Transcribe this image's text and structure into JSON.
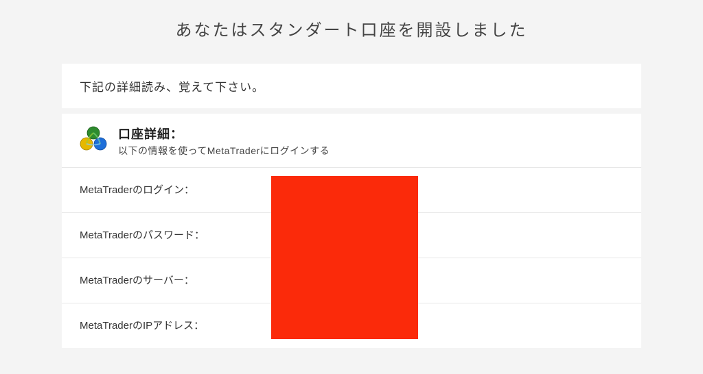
{
  "page": {
    "title": "あなたはスタンダート口座を開設しました"
  },
  "instruction": {
    "text": "下記の詳細読み、覚えて下さい。"
  },
  "details": {
    "header_title": "口座詳細：",
    "header_sub": "以下の情報を使ってMetaTraderにログインする",
    "rows": [
      {
        "label": "MetaTraderのログイン："
      },
      {
        "label": "MetaTraderのパスワード："
      },
      {
        "label": "MetaTraderのサーバー："
      },
      {
        "label": "MetaTraderのIPアドレス："
      }
    ]
  },
  "icon": {
    "name": "metatrader-icon"
  },
  "redaction": {
    "color": "#fb2a0a"
  }
}
